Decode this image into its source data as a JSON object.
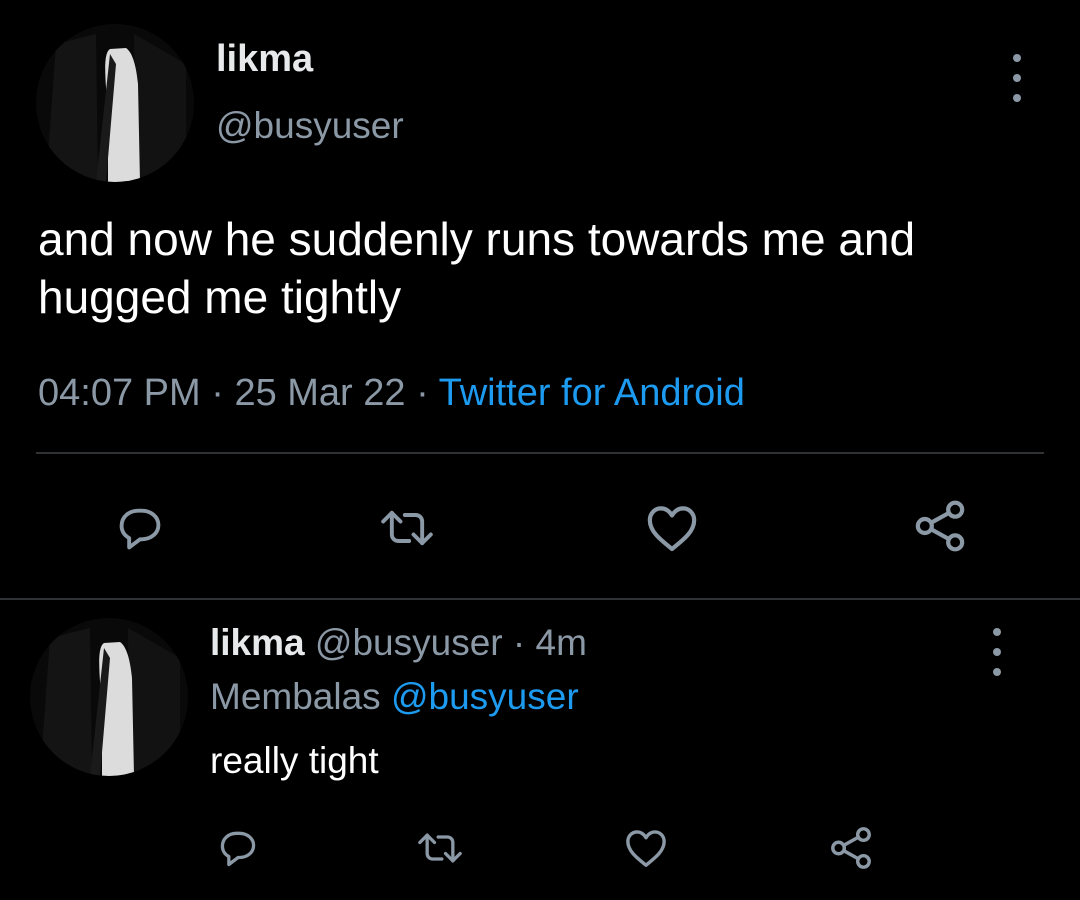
{
  "main_tweet": {
    "display_name": "likma",
    "handle": "@busyuser",
    "text": "and now he suddenly runs towards me and hugged me tightly",
    "time": "04:07 PM",
    "separator": " · ",
    "date": "25 Mar 22",
    "source": "Twitter for Android",
    "actions": {
      "reply_icon": "reply-icon",
      "retweet_icon": "retweet-icon",
      "like_icon": "heart-icon",
      "share_icon": "share-icon"
    }
  },
  "reply_tweet": {
    "display_name": "likma",
    "handle": "@busyuser",
    "separator": " · ",
    "age": "4m",
    "replying_label": "Membalas",
    "replying_to": "@busyuser",
    "text": "really tight"
  },
  "colors": {
    "background": "#000000",
    "text_primary": "#e7e9ea",
    "text_secondary": "#8b98a5",
    "accent": "#1d9bf0",
    "divider": "#2f3336",
    "icon": "#8b98a5"
  }
}
